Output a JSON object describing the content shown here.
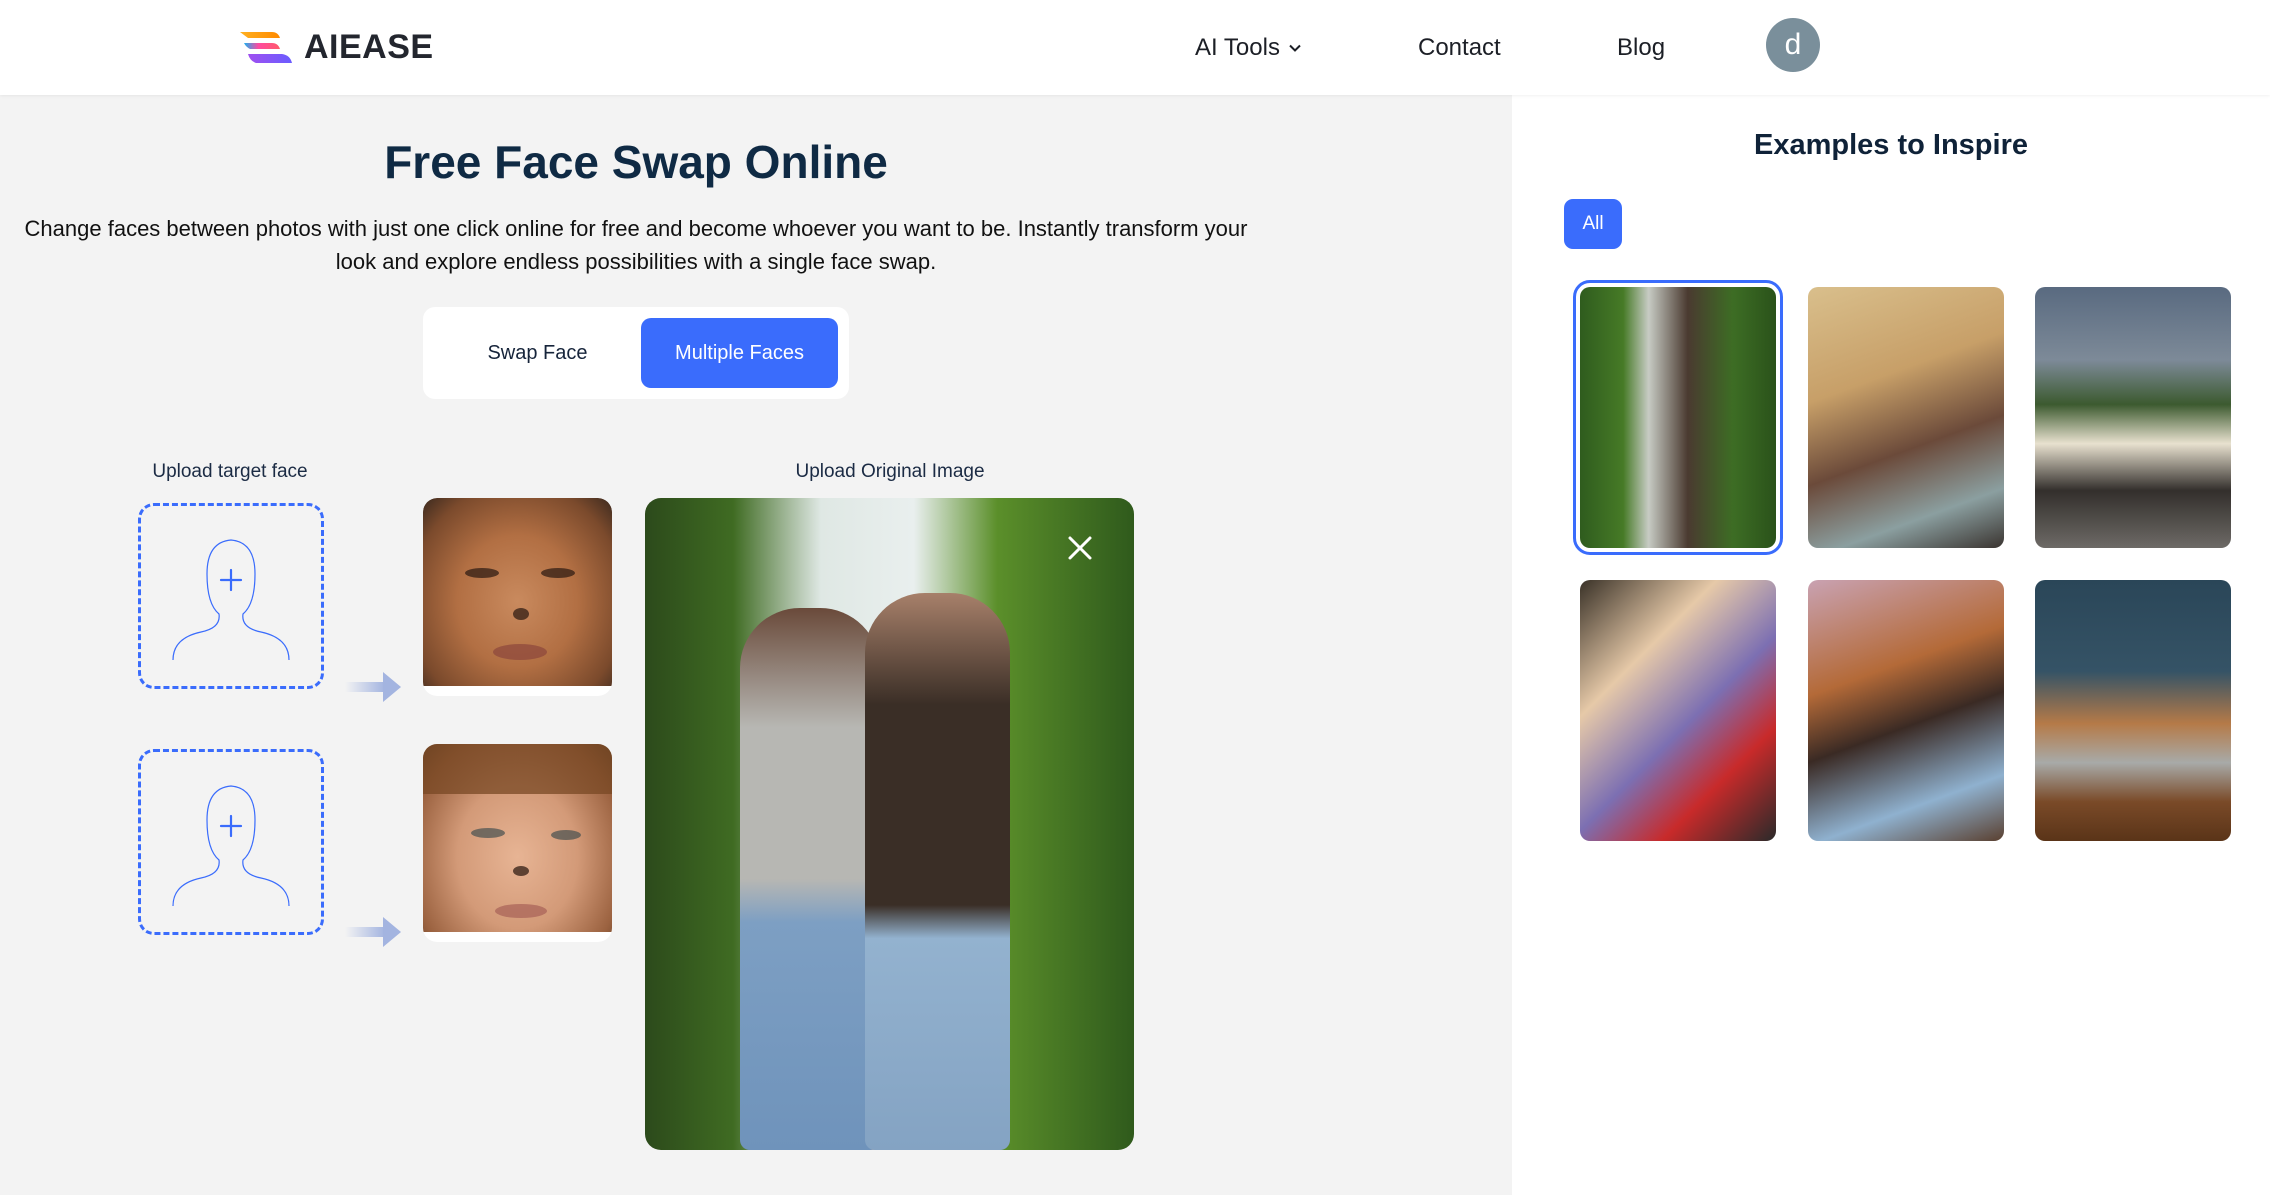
{
  "header": {
    "logo_text": "AIEASE",
    "nav": {
      "ai_tools": "AI Tools",
      "contact": "Contact",
      "blog": "Blog"
    },
    "avatar_initial": "d",
    "avatar_color": "#7a8f9b"
  },
  "main": {
    "title": "Free Face Swap Online",
    "description": "Change faces between photos with just one click online for free and become whoever you want to be. Instantly transform your look and explore endless possibilities with a single face swap.",
    "tabs": [
      {
        "label": "Swap Face",
        "active": false
      },
      {
        "label": "Multiple Faces",
        "active": true
      }
    ],
    "upload_target_label": "Upload target face",
    "upload_original_label": "Upload Original Image",
    "face_pairs": [
      {
        "upload_icon": "person-plus-icon",
        "detected_face": "face-1"
      },
      {
        "upload_icon": "person-plus-icon",
        "detected_face": "face-2"
      }
    ],
    "original_image": {
      "description": "Two women standing between hedges",
      "close_icon": "close-icon"
    }
  },
  "examples": {
    "title": "Examples to Inspire",
    "filters": [
      {
        "label": "All",
        "active": true
      }
    ],
    "items": [
      {
        "name": "two-women-hedges",
        "selected": true
      },
      {
        "name": "party-group",
        "selected": false
      },
      {
        "name": "two-men-railing",
        "selected": false
      },
      {
        "name": "couple-hug",
        "selected": false
      },
      {
        "name": "couple-seated",
        "selected": false
      },
      {
        "name": "two-women-laptop",
        "selected": false
      }
    ]
  },
  "colors": {
    "accent": "#3a6cfc",
    "title": "#0f2a44",
    "background": "#f3f3f3"
  }
}
